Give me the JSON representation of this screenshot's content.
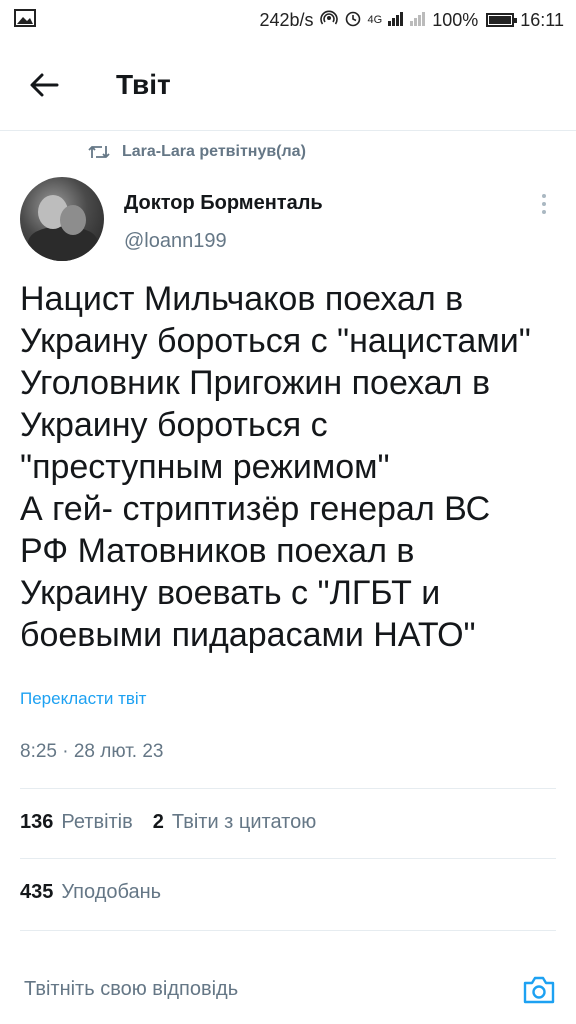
{
  "status_bar": {
    "network_speed": "242b/s",
    "network_type": "4G",
    "battery": "100%",
    "time": "16:11"
  },
  "header": {
    "title": "Твіт"
  },
  "retweet": {
    "text": "Lara-Lara ретвітнув(ла)"
  },
  "author": {
    "name": "Доктор Борменталь",
    "handle": "@loann199"
  },
  "tweet": {
    "lines": [
      "Нацист Мильчаков поехал в",
      "Украину бороться с \"нацистами\"",
      "Уголовник Пригожин поехал в",
      "Украину бороться с",
      "\"преступным режимом\"",
      "А гей- стриптизёр генерал ВС",
      "РФ Матовников поехал в",
      "Украину воевать с \"ЛГБТ и",
      "боевыми пидарасами НАТО\""
    ],
    "translate_label": "Перекласти твіт",
    "timestamp": "8:25 · 28 лют. 23"
  },
  "stats": {
    "retweets_count": "136",
    "retweets_label": "Ретвітів",
    "quotes_count": "2",
    "quotes_label": "Твіти з цитатою",
    "likes_count": "435",
    "likes_label": "Уподобань"
  },
  "reply": {
    "placeholder": "Твітніть свою відповідь"
  },
  "icons": {
    "back": "arrow-left-icon",
    "retweet": "retweet-icon",
    "more": "more-vertical-icon",
    "camera": "camera-icon"
  },
  "colors": {
    "accent": "#1da1f2",
    "secondary_text": "#657786",
    "primary_text": "#14171a",
    "divider": "#e6ecf0"
  }
}
